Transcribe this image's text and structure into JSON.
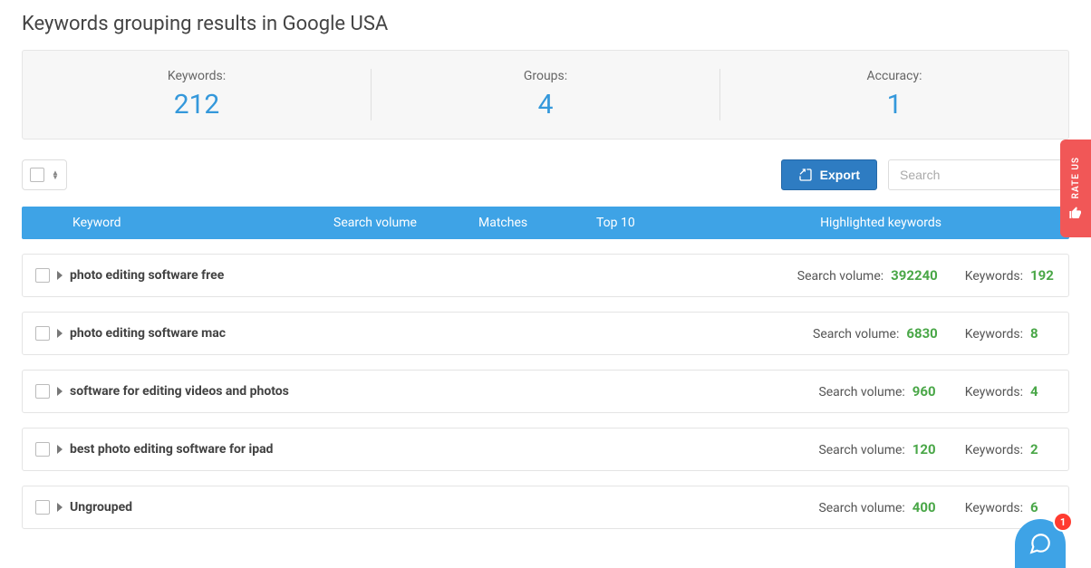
{
  "page_title": "Keywords grouping results in Google USA",
  "summary": {
    "keywords_label": "Keywords:",
    "keywords_value": "212",
    "groups_label": "Groups:",
    "groups_value": "4",
    "accuracy_label": "Accuracy:",
    "accuracy_value": "1"
  },
  "actions": {
    "export_label": "Export",
    "search_placeholder": "Search"
  },
  "table_header": {
    "keyword": "Keyword",
    "search_volume": "Search volume",
    "matches": "Matches",
    "top10": "Top 10",
    "highlighted": "Highlighted keywords"
  },
  "group_meta_labels": {
    "search_volume": "Search volume:",
    "keywords": "Keywords:"
  },
  "groups": [
    {
      "name": "photo editing software free",
      "search_volume": "392240",
      "keywords": "192"
    },
    {
      "name": "photo editing software mac",
      "search_volume": "6830",
      "keywords": "8"
    },
    {
      "name": "software for editing videos and photos",
      "search_volume": "960",
      "keywords": "4"
    },
    {
      "name": "best photo editing software for ipad",
      "search_volume": "120",
      "keywords": "2"
    },
    {
      "name": "Ungrouped",
      "search_volume": "400",
      "keywords": "6"
    }
  ],
  "rate_tab": {
    "label": "RATE US"
  },
  "chat": {
    "badge": "1"
  }
}
